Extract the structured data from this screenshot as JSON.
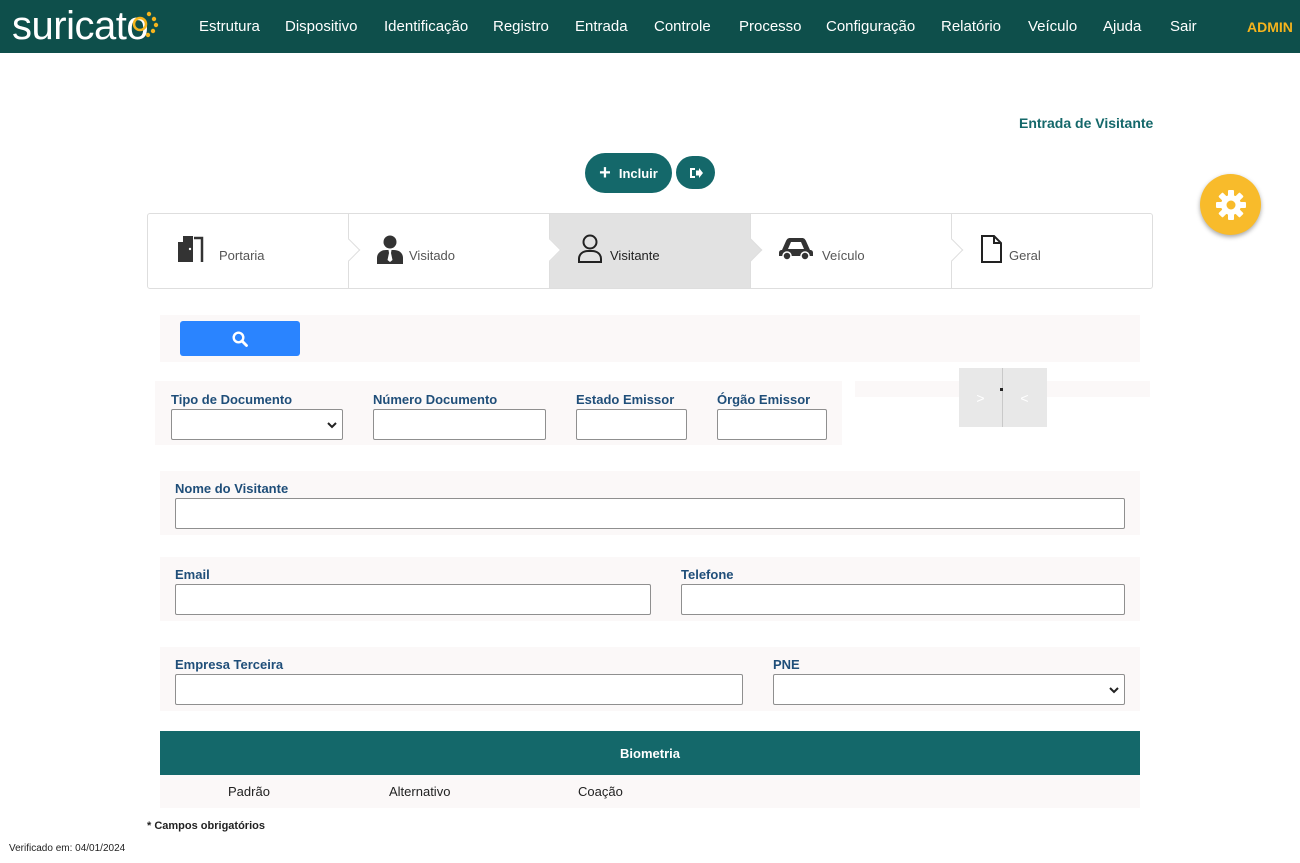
{
  "header": {
    "logo_text": "suricato",
    "nav": [
      "Estrutura",
      "Dispositivo",
      "Identificação",
      "Registro",
      "Entrada",
      "Controle",
      "Processo",
      "Configuração",
      "Relatório",
      "Veículo",
      "Ajuda",
      "Sair"
    ],
    "user": "ADMIN"
  },
  "page": {
    "title": "Entrada de Visitante",
    "incluir_label": "Incluir"
  },
  "steps": [
    {
      "label": "Portaria",
      "icon": "door-icon"
    },
    {
      "label": "Visitado",
      "icon": "person-tie-icon"
    },
    {
      "label": "Visitante",
      "icon": "user-outline-icon",
      "active": true
    },
    {
      "label": "Veículo",
      "icon": "car-icon"
    },
    {
      "label": "Geral",
      "icon": "file-icon"
    }
  ],
  "form": {
    "tipo_documento": {
      "label": "Tipo de Documento",
      "value": ""
    },
    "numero_documento": {
      "label": "Número Documento",
      "value": ""
    },
    "estado_emissor": {
      "label": "Estado Emissor",
      "value": ""
    },
    "orgao_emissor": {
      "label": "Órgão Emissor",
      "value": ""
    },
    "nome_visitante": {
      "label": "Nome do Visitante",
      "value": ""
    },
    "email": {
      "label": "Email",
      "value": ""
    },
    "telefone": {
      "label": "Telefone",
      "value": ""
    },
    "empresa_terceira": {
      "label": "Empresa Terceira",
      "value": ""
    },
    "pne": {
      "label": "PNE",
      "value": ""
    }
  },
  "photo_nav": {
    "next": ">",
    "prev": "<"
  },
  "biometria": {
    "title": "Biometria",
    "options": [
      "Padrão",
      "Alternativo",
      "Coação"
    ]
  },
  "footer": {
    "required_note": "* Campos obrigatórios",
    "verified": "Verificado em: 04/01/2024"
  },
  "colors": {
    "primary": "#14686a",
    "header_bg": "#0e4f4b",
    "accent": "#f8bb2b",
    "search": "#2a84ff"
  }
}
